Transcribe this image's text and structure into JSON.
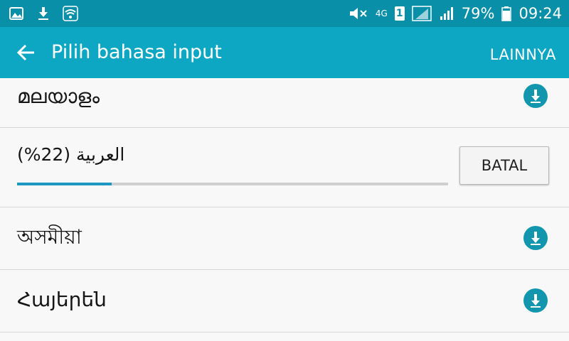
{
  "status_bar": {
    "battery": "79%",
    "time": "09:24",
    "network": "4G",
    "sim": "1",
    "icons": [
      "gallery-icon",
      "download-icon",
      "wifi-icon",
      "mute-icon",
      "signal-icon",
      "battery-icon"
    ]
  },
  "app_bar": {
    "title": "Pilih bahasa input",
    "more_label": "LAINNYA",
    "back_icon": "arrow-left-icon"
  },
  "languages": [
    {
      "label": "മലയാളം",
      "action_icon": "download-icon"
    },
    {
      "label": "العربية (22%)",
      "progress": 0.22,
      "cancel_label": "BATAL"
    },
    {
      "label": "অসমীয়া",
      "action_icon": "download-icon"
    },
    {
      "label": "Հայերեն",
      "action_icon": "download-icon"
    }
  ],
  "colors": {
    "status_bar": "#0a8fa9",
    "app_bar": "#0da7c4",
    "accent": "#1196ae",
    "progress": "#1c98c3"
  }
}
